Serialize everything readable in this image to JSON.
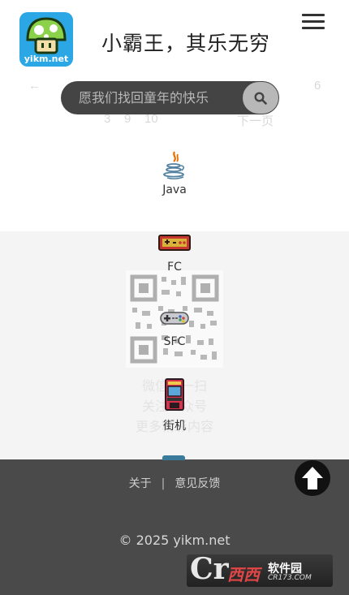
{
  "header": {
    "logo_text": "yikm.net",
    "slogan": "小霸王，其乐无穷"
  },
  "search": {
    "placeholder": "愿我们找回童年的快乐"
  },
  "ghost": {
    "row1_left": "←",
    "row1_num": "6",
    "row2_nums": "3    9    10",
    "row2_right": "下一页"
  },
  "categories": [
    {
      "label": "Java",
      "icon": "java-icon"
    },
    {
      "label": "FC",
      "icon": "fc-console-icon"
    },
    {
      "label": "SFC",
      "icon": "sfc-gamepad-icon"
    },
    {
      "label": "街机",
      "icon": "arcade-cabinet-icon"
    }
  ],
  "ghost_lines": [
    "微信扫一扫",
    "关注公众号",
    "更多精彩内容"
  ],
  "footer": {
    "about": "关于",
    "separator": "|",
    "feedback": "意见反馈",
    "copyright": "© 2025 yikm.net"
  },
  "watermark": {
    "cr": "Cr",
    "name": "西西",
    "site": "软件园",
    "domain": "CR173.COM"
  },
  "colors": {
    "footer_bg": "#4a4a4a",
    "search_bg": "#444444",
    "logo_bg": "#2ba7e6"
  }
}
